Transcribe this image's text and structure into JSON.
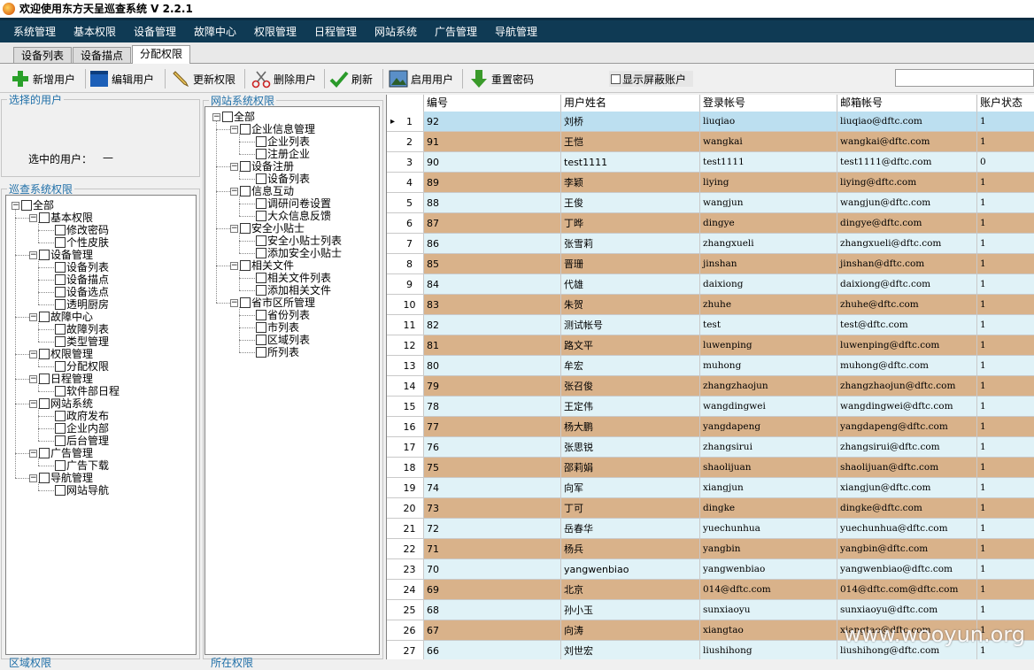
{
  "window": {
    "title": "欢迎使用东方天呈巡查系统 V 2.2.1"
  },
  "menu": [
    "系统管理",
    "基本权限",
    "设备管理",
    "故障中心",
    "权限管理",
    "日程管理",
    "网站系统",
    "广告管理",
    "导航管理"
  ],
  "tabs": [
    {
      "label": "设备列表",
      "active": false
    },
    {
      "label": "设备描点",
      "active": false
    },
    {
      "label": "分配权限",
      "active": true
    }
  ],
  "toolbar": {
    "add_user": "新增用户",
    "edit_user": "编辑用户",
    "update_perm": "更新权限",
    "delete_user": "删除用户",
    "refresh": "刷新",
    "enable_user": "启用用户",
    "reset_password": "重置密码",
    "show_hidden": "显示屏蔽账户"
  },
  "selected_user": {
    "legend": "选择的用户",
    "label": "选中的用户：",
    "value": "—"
  },
  "patrol_perm": {
    "legend": "巡查系统权限",
    "root": "全部",
    "groups": [
      {
        "label": "基本权限",
        "children": [
          "修改密码",
          "个性皮肤"
        ]
      },
      {
        "label": "设备管理",
        "children": [
          "设备列表",
          "设备描点",
          "设备选点",
          "透明厨房"
        ]
      },
      {
        "label": "故障中心",
        "children": [
          "故障列表",
          "类型管理"
        ]
      },
      {
        "label": "权限管理",
        "children": [
          "分配权限"
        ]
      },
      {
        "label": "日程管理",
        "children": [
          "软件部日程"
        ]
      },
      {
        "label": "网站系统",
        "children": [
          "政府发布",
          "企业内部",
          "后台管理"
        ]
      },
      {
        "label": "广告管理",
        "children": [
          "广告下载"
        ]
      },
      {
        "label": "导航管理",
        "children": [
          "网站导航"
        ]
      }
    ]
  },
  "web_perm": {
    "legend": "网站系统权限",
    "root": "全部",
    "groups": [
      {
        "label": "企业信息管理",
        "children": [
          "企业列表",
          "注册企业"
        ]
      },
      {
        "label": "设备注册",
        "children": [
          "设备列表"
        ]
      },
      {
        "label": "信息互动",
        "children": [
          "调研问卷设置",
          "大众信息反馈"
        ]
      },
      {
        "label": "安全小贴士",
        "children": [
          "安全小贴士列表",
          "添加安全小贴士"
        ]
      },
      {
        "label": "相关文件",
        "children": [
          "相关文件列表",
          "添加相关文件"
        ]
      },
      {
        "label": "省市区所管理",
        "children": [
          "省份列表",
          "市列表",
          "区域列表",
          "所列表"
        ]
      }
    ]
  },
  "bottom_legends": [
    "区域权限",
    "所在权限"
  ],
  "grid": {
    "columns": [
      "编号",
      "用户姓名",
      "登录帐号",
      "邮箱帐号",
      "账户状态"
    ],
    "rows": [
      [
        "1",
        "92",
        "刘桥",
        "liuqiao",
        "liuqiao@dftc.com",
        "1"
      ],
      [
        "2",
        "91",
        "王恺",
        "wangkai",
        "wangkai@dftc.com",
        "1"
      ],
      [
        "3",
        "90",
        "test1111",
        "test1111",
        "test1111@dftc.com",
        "0"
      ],
      [
        "4",
        "89",
        "李颖",
        "liying",
        "liying@dftc.com",
        "1"
      ],
      [
        "5",
        "88",
        "王俊",
        "wangjun",
        "wangjun@dftc.com",
        "1"
      ],
      [
        "6",
        "87",
        "丁晔",
        "dingye",
        "dingye@dftc.com",
        "1"
      ],
      [
        "7",
        "86",
        "张雪莉",
        "zhangxueli",
        "zhangxueli@dftc.com",
        "1"
      ],
      [
        "8",
        "85",
        "晋珊",
        "jinshan",
        "jinshan@dftc.com",
        "1"
      ],
      [
        "9",
        "84",
        "代雄",
        "daixiong",
        "daixiong@dftc.com",
        "1"
      ],
      [
        "10",
        "83",
        "朱贺",
        "zhuhe",
        "zhuhe@dftc.com",
        "1"
      ],
      [
        "11",
        "82",
        "测试帐号",
        "test",
        "test@dftc.com",
        "1"
      ],
      [
        "12",
        "81",
        "路文平",
        "luwenping",
        "luwenping@dftc.com",
        "1"
      ],
      [
        "13",
        "80",
        "牟宏",
        "muhong",
        "muhong@dftc.com",
        "1"
      ],
      [
        "14",
        "79",
        "张召俊",
        "zhangzhaojun",
        "zhangzhaojun@dftc.com",
        "1"
      ],
      [
        "15",
        "78",
        "王定伟",
        "wangdingwei",
        "wangdingwei@dftc.com",
        "1"
      ],
      [
        "16",
        "77",
        "杨大鹏",
        "yangdapeng",
        "yangdapeng@dftc.com",
        "1"
      ],
      [
        "17",
        "76",
        "张思锐",
        "zhangsirui",
        "zhangsirui@dftc.com",
        "1"
      ],
      [
        "18",
        "75",
        "邵莉娟",
        "shaolijuan",
        "shaolijuan@dftc.com",
        "1"
      ],
      [
        "19",
        "74",
        "向军",
        "xiangjun",
        "xiangjun@dftc.com",
        "1"
      ],
      [
        "20",
        "73",
        "丁可",
        "dingke",
        "dingke@dftc.com",
        "1"
      ],
      [
        "21",
        "72",
        "岳春华",
        "yuechunhua",
        "yuechunhua@dftc.com",
        "1"
      ],
      [
        "22",
        "71",
        "杨兵",
        "yangbin",
        "yangbin@dftc.com",
        "1"
      ],
      [
        "23",
        "70",
        "yangwenbiao",
        "yangwenbiao",
        "yangwenbiao@dftc.com",
        "1"
      ],
      [
        "24",
        "69",
        "北京",
        "014@dftc.com",
        "014@dftc.com@dftc.com",
        "1"
      ],
      [
        "25",
        "68",
        "孙小玉",
        "sunxiaoyu",
        "sunxiaoyu@dftc.com",
        "1"
      ],
      [
        "26",
        "67",
        "向涛",
        "xiangtao",
        "xiangtao@dftc.com",
        "1"
      ],
      [
        "27",
        "66",
        "刘世宏",
        "liushihong",
        "liushihong@dftc.com",
        "1"
      ]
    ],
    "selected_row": 0
  },
  "colors": {
    "menu_bg": "#0f3a54",
    "row_odd": "#e0f2f7",
    "row_even": "#d9b28a",
    "row_selected": "#bcdff0",
    "legend": "#1f6fa8"
  },
  "watermark": "www.wooyun.org"
}
